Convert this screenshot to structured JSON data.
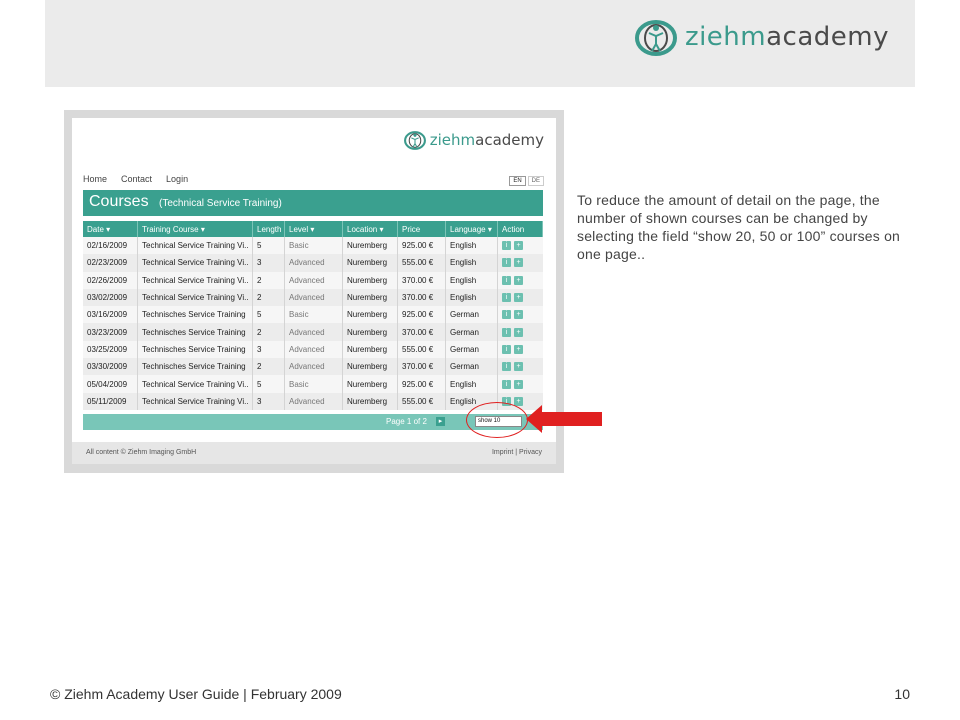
{
  "slide": {
    "brand": {
      "word1": "ziehm",
      "word2": "academy"
    },
    "explanation": "To reduce the amount of detail on the page, the number of shown courses can be changed by selecting the field “show 20, 50 or 100” courses on one page..",
    "footer": "© Ziehm Academy User Guide | February 2009",
    "page_number": "10"
  },
  "app": {
    "logo": {
      "word1": "ziehm",
      "word2": "academy"
    },
    "nav": [
      "Home",
      "Contact",
      "Login"
    ],
    "lang": [
      "EN",
      "DE"
    ],
    "courses_title": "Courses",
    "courses_subtitle": "(Technical Service Training)",
    "columns": [
      "Date ▾",
      "Training Course ▾",
      "Length",
      "Level ▾",
      "Location ▾",
      "Price",
      "Language ▾",
      "Action"
    ],
    "rows": [
      {
        "date": "02/16/2009",
        "course": "Technical Service Training Vi..",
        "length": "5",
        "level": "Basic",
        "location": "Nuremberg",
        "price": "925.00 €",
        "language": "English"
      },
      {
        "date": "02/23/2009",
        "course": "Technical Service Training Vi..",
        "length": "3",
        "level": "Advanced",
        "location": "Nuremberg",
        "price": "555.00 €",
        "language": "English"
      },
      {
        "date": "02/26/2009",
        "course": "Technical Service Training Vi..",
        "length": "2",
        "level": "Advanced",
        "location": "Nuremberg",
        "price": "370.00 €",
        "language": "English"
      },
      {
        "date": "03/02/2009",
        "course": "Technical Service Training Vi..",
        "length": "2",
        "level": "Advanced",
        "location": "Nuremberg",
        "price": "370.00 €",
        "language": "English"
      },
      {
        "date": "03/16/2009",
        "course": "Technisches Service Training",
        "length": "5",
        "level": "Basic",
        "location": "Nuremberg",
        "price": "925.00 €",
        "language": "German"
      },
      {
        "date": "03/23/2009",
        "course": "Technisches Service Training",
        "length": "2",
        "level": "Advanced",
        "location": "Nuremberg",
        "price": "370.00 €",
        "language": "German"
      },
      {
        "date": "03/25/2009",
        "course": "Technisches Service Training",
        "length": "3",
        "level": "Advanced",
        "location": "Nuremberg",
        "price": "555.00 €",
        "language": "German"
      },
      {
        "date": "03/30/2009",
        "course": "Technisches Service Training",
        "length": "2",
        "level": "Advanced",
        "location": "Nuremberg",
        "price": "370.00 €",
        "language": "German"
      },
      {
        "date": "05/04/2009",
        "course": "Technical Service Training Vi..",
        "length": "5",
        "level": "Basic",
        "location": "Nuremberg",
        "price": "925.00 €",
        "language": "English"
      },
      {
        "date": "05/11/2009",
        "course": "Technical Service Training Vi..",
        "length": "3",
        "level": "Advanced",
        "location": "Nuremberg",
        "price": "555.00 €",
        "language": "English"
      }
    ],
    "action_icons": [
      "info-icon",
      "register-icon"
    ],
    "pager_text": "Page 1 of 2",
    "pager_next": "▸",
    "show_select": "show 10",
    "footer_left": "All content © Ziehm Imaging GmbH",
    "footer_right": "Imprint  |  Privacy"
  },
  "colors": {
    "accent": "#3aa08f",
    "highlight": "#e02020"
  }
}
